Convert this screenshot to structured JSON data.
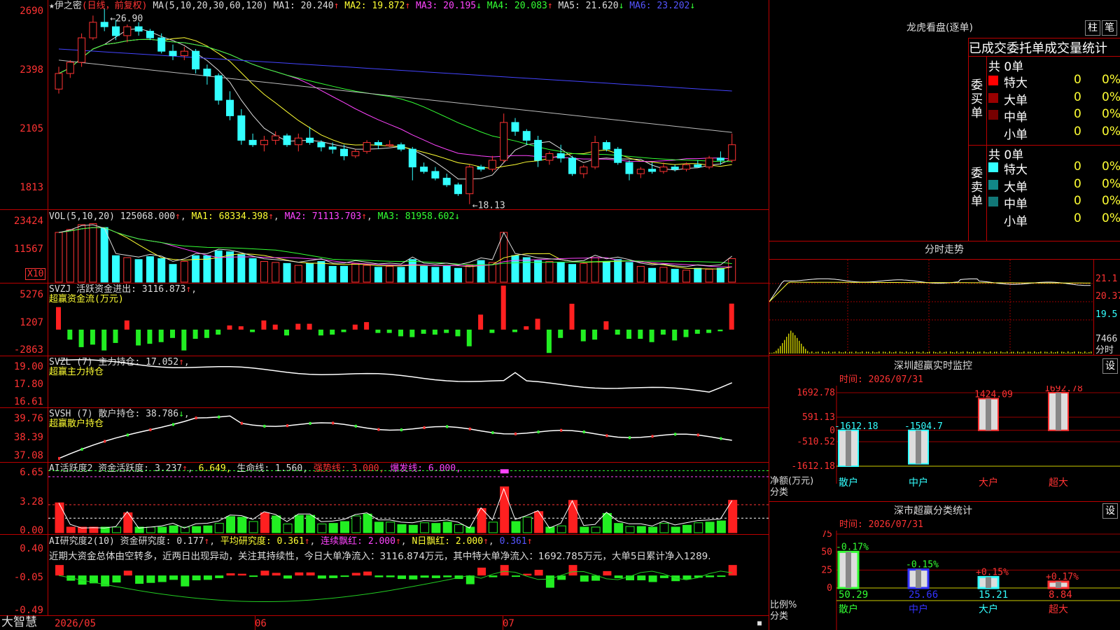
{
  "stock": {
    "name": "伊之密",
    "period_label": "(日线，前复权)",
    "ma_label": "MA(5,10,20,30,60,120)",
    "ma_values": [
      {
        "label": "MA1:",
        "value": "20.240",
        "arrow": "↑",
        "color": "#dddddd"
      },
      {
        "label": "MA2:",
        "value": "19.872",
        "arrow": "↑",
        "color": "#ffff33"
      },
      {
        "label": "MA3:",
        "value": "20.195",
        "arrow": "↓",
        "color": "#ff44ff"
      },
      {
        "label": "MA4:",
        "value": "20.083",
        "arrow": "↑",
        "color": "#33ff33"
      },
      {
        "label": "MA5:",
        "value": "21.620",
        "arrow": "↓",
        "color": "#dddddd"
      },
      {
        "label": "MA6:",
        "value": "23.202",
        "arrow": "↓",
        "color": "#5555ff"
      }
    ],
    "high_label": "←26.90",
    "low_label": "←18.13"
  },
  "price_axis": [
    "2690",
    "2398",
    "2105",
    "1813"
  ],
  "vol": {
    "label": "VOL(5,10,20)",
    "value": "125068.000",
    "ma1": "MA1: 68334.398",
    "ma2": "MA2: 71113.703",
    "ma3": "MA3: 81958.602",
    "axis": [
      "23424",
      "11567"
    ],
    "unit": "X10"
  },
  "svzj": {
    "label": "SVZJ  活跃资金进出: 3116.873",
    "sub": "超赢资金流(万元)",
    "axis": [
      "5276",
      "1207",
      "-2863"
    ]
  },
  "svzl": {
    "label": "SVZL (7) 主力持仓: 17.052",
    "sub": "超赢主力持仓",
    "axis": [
      "19.00",
      "17.80",
      "16.61"
    ]
  },
  "svsh": {
    "label": "SVSH (7) 散户持仓: 38.786",
    "sub": "超赢散户持仓",
    "axis": [
      "39.76",
      "38.39",
      "37.08"
    ]
  },
  "ai1": {
    "label": "AI活跃度2 资金活跃度: 3.237",
    "v2": "6.649,",
    "life": "生命线: 1.560,",
    "strong": "强势线: 3.000,",
    "burst": "爆发线: 6.000,",
    "axis": [
      "6.65",
      "3.28",
      "0.00"
    ]
  },
  "ai2": {
    "label": "AI研究度2(10) 资金研究度: 0.177",
    "avg": "平均研究度: 0.361",
    "red": "连续飘红: 2.000",
    "nred": "N日飘红: 2.000",
    "last": "0.361",
    "note": "近期大资金总体由空转多，近两日出现异动，关注其持续性，今日大单净流入：3116.874万元，其中特大单净流入：1692.785万元，大单5日累计净入1289.",
    "axis": [
      "0.40",
      "-0.05",
      "-0.49"
    ]
  },
  "date_axis": [
    "2026/05",
    "06",
    "07"
  ],
  "brand": "大智慧",
  "right": {
    "dragon_title": "龙虎看盘(逐单)",
    "btn_zhu": "柱",
    "btn_bi": "笔",
    "stat_title": "已成交委托单成交量统计",
    "buy_label": "委买单",
    "sell_label": "委卖单",
    "buy_total": "共 0单",
    "sell_total": "共 0单",
    "buy_rows": [
      {
        "name": "特大",
        "count": "0",
        "pct": "0%",
        "color": "#ff0000"
      },
      {
        "name": "大单",
        "count": "0",
        "pct": "0%",
        "color": "#990000"
      },
      {
        "name": "中单",
        "count": "0",
        "pct": "0%",
        "color": "#770000"
      },
      {
        "name": "小单",
        "count": "0",
        "pct": "0%",
        "color": "#000000"
      }
    ],
    "sell_rows": [
      {
        "name": "特大",
        "count": "0",
        "pct": "0%",
        "color": "#33ffff"
      },
      {
        "name": "大单",
        "count": "0",
        "pct": "0%",
        "color": "#118888"
      },
      {
        "name": "中单",
        "count": "0",
        "pct": "0%",
        "color": "#117777"
      },
      {
        "name": "小单",
        "count": "0",
        "pct": "0%",
        "color": "#000000"
      }
    ],
    "fenshi_title": "分时走势",
    "fenshi_axis": [
      "21.1",
      "20.37",
      "19.5",
      "7466"
    ],
    "fenshi_unit": "分时",
    "sz_title": "深圳超赢实时监控",
    "sz_btn": "设",
    "sz_time": "时间: 2026/07/31",
    "sz_axis": [
      "1692.78",
      "591.13",
      "0",
      "-510.52",
      "-1612.18"
    ],
    "sz_ylabel": "净额(万元)",
    "sz_xlabel": "分类",
    "sz_cats": [
      "散户",
      "中户",
      "大户",
      "超大"
    ],
    "sz_vals": [
      -1612.18,
      -1504.7,
      1424.09,
      1692.78
    ],
    "sz_val_labels": [
      "-1612.18",
      "-1504.7",
      "1424.09",
      "1692.78"
    ],
    "ss_title": "深市超赢分类统计",
    "ss_btn": "设",
    "ss_time": "时间: 2026/07/31",
    "ss_axis": [
      "75",
      "50",
      "25",
      "0"
    ],
    "ss_ylabel": "比例%",
    "ss_xlabel": "分类",
    "ss_cats": [
      "散户",
      "中户",
      "大户",
      "超大"
    ],
    "ss_vals": [
      50.29,
      25.66,
      15.21,
      8.84
    ],
    "ss_val_labels": [
      "50.29",
      "25.66",
      "15.21",
      "8.84"
    ],
    "ss_chg": [
      "-0.17%",
      "-0.15%",
      "+0.15%",
      "+0.17%"
    ]
  },
  "chart_data": {
    "type": "bar",
    "title": "伊之密 (日线，前复权)",
    "price_range": [
      18.13,
      26.9
    ],
    "candles_ohlc": [
      [
        23.3,
        24.3,
        23.1,
        24.0
      ],
      [
        24.0,
        24.6,
        23.8,
        24.5
      ],
      [
        24.5,
        25.8,
        24.3,
        25.6
      ],
      [
        25.6,
        26.6,
        25.5,
        26.3
      ],
      [
        26.3,
        26.9,
        25.9,
        26.1
      ],
      [
        26.1,
        26.4,
        25.5,
        25.7
      ],
      [
        25.7,
        26.2,
        25.4,
        26.1
      ],
      [
        26.1,
        26.3,
        25.7,
        25.9
      ],
      [
        25.9,
        26.0,
        25.5,
        25.6
      ],
      [
        25.6,
        25.8,
        24.9,
        25.0
      ],
      [
        25.0,
        25.3,
        24.6,
        24.8
      ],
      [
        24.8,
        25.2,
        24.6,
        25.0
      ],
      [
        25.0,
        25.1,
        24.0,
        24.2
      ],
      [
        24.2,
        24.4,
        23.5,
        23.9
      ],
      [
        23.9,
        24.0,
        22.6,
        22.8
      ],
      [
        22.8,
        23.2,
        21.9,
        22.1
      ],
      [
        22.1,
        22.4,
        20.8,
        21.0
      ],
      [
        21.0,
        21.3,
        20.7,
        20.8
      ],
      [
        20.8,
        21.2,
        20.5,
        21.0
      ],
      [
        21.0,
        21.4,
        20.8,
        21.2
      ],
      [
        21.2,
        21.3,
        20.7,
        20.8
      ],
      [
        20.8,
        21.3,
        20.5,
        21.1
      ],
      [
        21.1,
        21.6,
        20.8,
        20.9
      ],
      [
        20.9,
        21.0,
        20.5,
        20.7
      ],
      [
        20.7,
        20.9,
        20.4,
        20.6
      ],
      [
        20.6,
        20.8,
        20.1,
        20.3
      ],
      [
        20.3,
        20.6,
        20.2,
        20.5
      ],
      [
        20.5,
        21.0,
        20.4,
        20.9
      ],
      [
        20.9,
        21.0,
        20.6,
        20.8
      ],
      [
        20.8,
        21.0,
        20.7,
        20.8
      ],
      [
        20.8,
        20.9,
        20.5,
        20.6
      ],
      [
        20.6,
        20.7,
        19.2,
        19.8
      ],
      [
        19.8,
        20.0,
        19.5,
        19.6
      ],
      [
        19.6,
        19.8,
        19.2,
        19.3
      ],
      [
        19.3,
        19.5,
        18.9,
        19.0
      ],
      [
        19.0,
        19.1,
        18.5,
        18.6
      ],
      [
        18.6,
        19.9,
        18.13,
        19.8
      ],
      [
        19.8,
        19.9,
        19.6,
        19.7
      ],
      [
        19.7,
        20.3,
        19.6,
        20.1
      ],
      [
        20.1,
        22.2,
        20.0,
        21.8
      ],
      [
        21.8,
        22.0,
        21.2,
        21.4
      ],
      [
        21.4,
        21.5,
        20.8,
        21.0
      ],
      [
        21.0,
        21.2,
        19.8,
        20.1
      ],
      [
        20.1,
        20.5,
        19.9,
        20.4
      ],
      [
        20.4,
        20.8,
        20.0,
        20.2
      ],
      [
        20.2,
        20.3,
        19.4,
        19.5
      ],
      [
        19.5,
        19.9,
        19.3,
        19.8
      ],
      [
        19.8,
        21.2,
        19.7,
        20.9
      ],
      [
        20.9,
        21.0,
        20.5,
        20.6
      ],
      [
        20.6,
        20.7,
        19.9,
        20.0
      ],
      [
        20.0,
        20.1,
        19.2,
        19.5
      ],
      [
        19.5,
        19.8,
        19.3,
        19.7
      ],
      [
        19.7,
        20.0,
        19.5,
        19.6
      ],
      [
        19.6,
        20.0,
        19.5,
        19.8
      ],
      [
        19.8,
        19.9,
        19.6,
        19.7
      ],
      [
        19.7,
        20.0,
        19.6,
        19.9
      ],
      [
        19.9,
        20.1,
        19.8,
        19.8
      ],
      [
        19.8,
        20.3,
        19.7,
        20.2
      ],
      [
        20.2,
        20.5,
        19.9,
        20.1
      ],
      [
        20.1,
        21.3,
        20.0,
        20.8
      ]
    ],
    "volume": [
      52,
      55,
      60,
      61,
      57,
      28,
      26,
      24,
      27,
      25,
      19,
      22,
      28,
      28,
      33,
      32,
      29,
      25,
      22,
      21,
      20,
      18,
      20,
      22,
      17,
      17,
      20,
      18,
      16,
      17,
      16,
      24,
      17,
      16,
      17,
      15,
      18,
      23,
      21,
      52,
      28,
      26,
      23,
      22,
      21,
      19,
      20,
      26,
      22,
      24,
      21,
      17,
      15,
      16,
      14,
      13,
      15,
      14,
      15,
      25
    ],
    "svzj": [
      2700,
      -1200,
      -2100,
      -1800,
      -2500,
      -1600,
      1100,
      -1900,
      -1700,
      -1500,
      -1000,
      -2500,
      -1100,
      -1000,
      -600,
      500,
      400,
      -300,
      1100,
      600,
      -700,
      700,
      700,
      -700,
      -600,
      -300,
      600,
      900,
      -400,
      -400,
      -800,
      -900,
      -500,
      -600,
      -400,
      -800,
      -2000,
      1800,
      -400,
      5276,
      -300,
      400,
      1300,
      -2800,
      -1000,
      3100,
      -1400,
      -1200,
      1000,
      -600,
      -1100,
      -1100,
      -1500,
      -600,
      -1300,
      -900,
      -500,
      -400,
      -200,
      3116
    ]
  }
}
